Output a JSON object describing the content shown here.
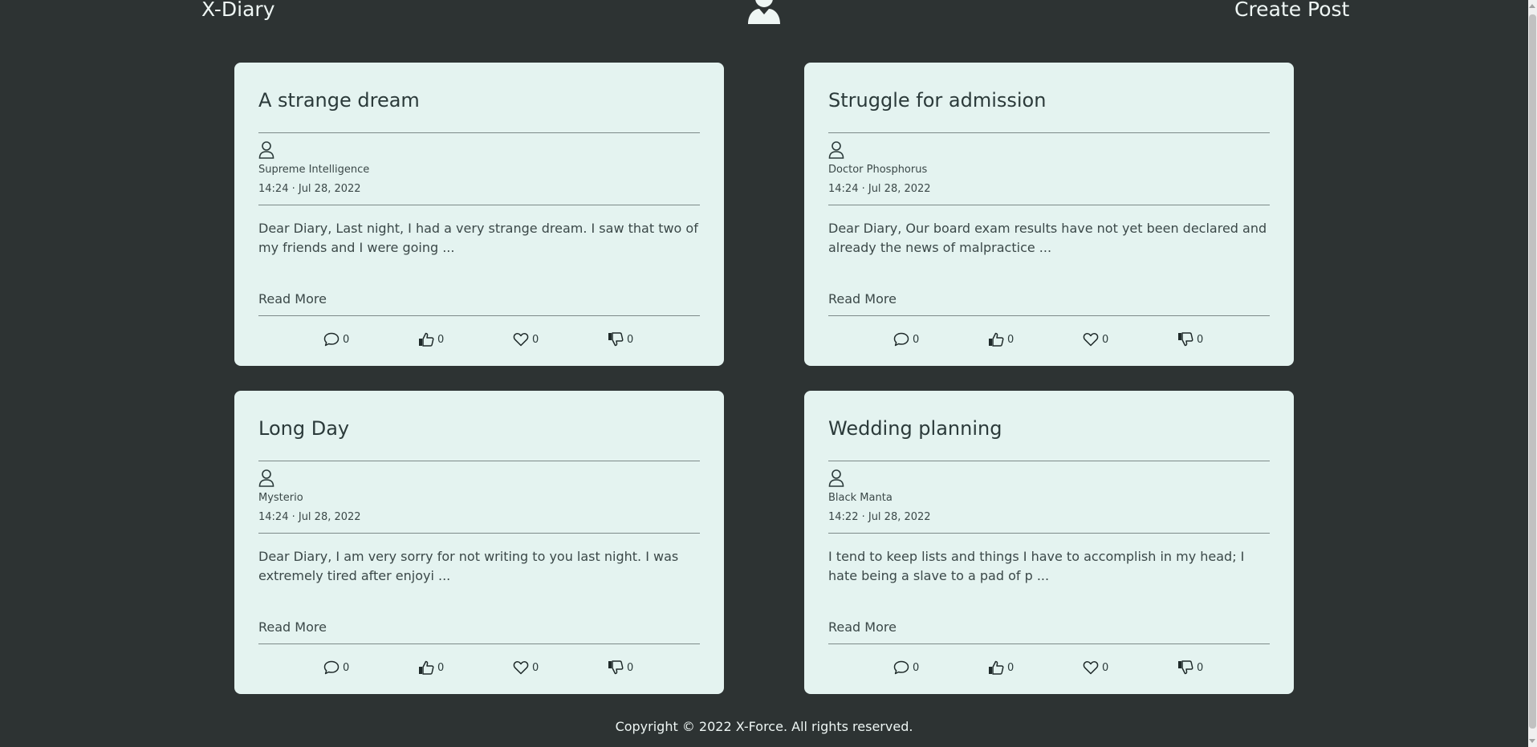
{
  "header": {
    "brand": "X-Diary",
    "avatar_icon": "user-silhouette-icon",
    "create_post_label": "Create Post"
  },
  "posts": [
    {
      "title": "A strange dream",
      "author": "Supreme Intelligence",
      "date": "14:24 · Jul 28, 2022",
      "excerpt": "Dear Diary, Last night, I had a very strange dream. I saw that two of my friends and I were going ...",
      "read_more": "Read More",
      "comments": "0",
      "likes": "0",
      "loves": "0",
      "dislikes": "0"
    },
    {
      "title": "Struggle for admission",
      "author": "Doctor Phosphorus",
      "date": "14:24 · Jul 28, 2022",
      "excerpt": "Dear Diary, Our board exam results have not yet been declared and already the news of malpractice ...",
      "read_more": "Read More",
      "comments": "0",
      "likes": "0",
      "loves": "0",
      "dislikes": "0"
    },
    {
      "title": "Long Day",
      "author": "Mysterio",
      "date": "14:24 · Jul 28, 2022",
      "excerpt": "Dear Diary, I am very sorry for not writing to you last night. I was extremely tired after enjoyi ...",
      "read_more": "Read More",
      "comments": "0",
      "likes": "0",
      "loves": "0",
      "dislikes": "0"
    },
    {
      "title": "Wedding planning",
      "author": "Black Manta",
      "date": "14:22 · Jul 28, 2022",
      "excerpt": "I tend to keep lists and things I have to accomplish in my head; I hate being a slave to a pad of p ...",
      "read_more": "Read More",
      "comments": "0",
      "likes": "0",
      "loves": "0",
      "dislikes": "0"
    }
  ],
  "footer": {
    "copyright": "Copyright © 2022 X-Force. All rights reserved."
  },
  "colors": {
    "background": "#2d3333",
    "card": "#e4f3f0",
    "header_text": "#eef6f4"
  }
}
